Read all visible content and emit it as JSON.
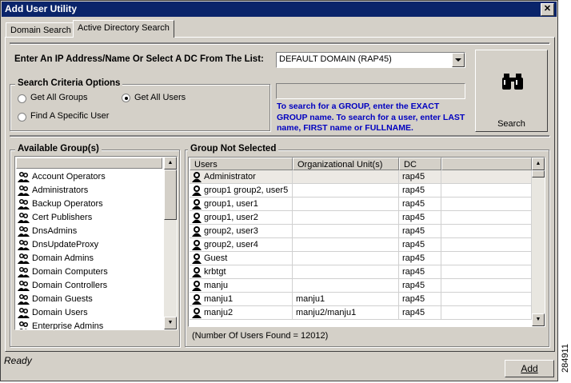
{
  "window": {
    "title": "Add User Utility",
    "close_label": "✕"
  },
  "tabs": [
    {
      "label": "Domain Search"
    },
    {
      "label": "Active Directory Search"
    }
  ],
  "dc_select": {
    "label": "Enter An IP Address/Name Or Select A DC From The List:",
    "value": "DEFAULT DOMAIN (RAP45)"
  },
  "search_criteria": {
    "title": "Search Criteria Options",
    "options": [
      {
        "label": "Get All Groups",
        "selected": false
      },
      {
        "label": "Get All Users",
        "selected": true
      },
      {
        "label": "Find A Specific User",
        "selected": false
      }
    ],
    "search_input_value": "",
    "help_text": "To search for a GROUP, enter the EXACT GROUP name. To search for a user, enter LAST name, FIRST name or FULLNAME."
  },
  "search_button": {
    "label": "Search",
    "icon": "binoculars-icon"
  },
  "available_groups": {
    "title": "Available Group(s)",
    "items": [
      "Account Operators",
      "Administrators",
      "Backup Operators",
      "Cert Publishers",
      "DnsAdmins",
      "DnsUpdateProxy",
      "Domain Admins",
      "Domain Computers",
      "Domain Controllers",
      "Domain Guests",
      "Domain Users",
      "Enterprise Admins"
    ]
  },
  "group_not_selected": {
    "title": "Group Not Selected",
    "columns": [
      "Users",
      "Organizational Unit(s)",
      "DC"
    ],
    "rows": [
      {
        "user": "Administrator",
        "ou": "",
        "dc": "rap45"
      },
      {
        "user": "group1 group2, user5",
        "ou": "",
        "dc": "rap45"
      },
      {
        "user": "group1, user1",
        "ou": "",
        "dc": "rap45"
      },
      {
        "user": "group1, user2",
        "ou": "",
        "dc": "rap45"
      },
      {
        "user": "group2, user3",
        "ou": "",
        "dc": "rap45"
      },
      {
        "user": "group2, user4",
        "ou": "",
        "dc": "rap45"
      },
      {
        "user": "Guest",
        "ou": "",
        "dc": "rap45"
      },
      {
        "user": "krbtgt",
        "ou": "",
        "dc": "rap45"
      },
      {
        "user": "manju",
        "ou": "",
        "dc": "rap45"
      },
      {
        "user": "manju1",
        "ou": "manju1",
        "dc": "rap45"
      },
      {
        "user": "manju2",
        "ou": "manju2/manju1",
        "dc": "rap45"
      }
    ],
    "count_text": "(Number Of Users Found = 12012)"
  },
  "status": {
    "text": "Ready"
  },
  "add_button": {
    "label": "Add"
  },
  "figure_id": "284911",
  "colors": {
    "title_bar": "#0a246a",
    "help_text": "#0000c0",
    "face": "#d4d0c8"
  }
}
